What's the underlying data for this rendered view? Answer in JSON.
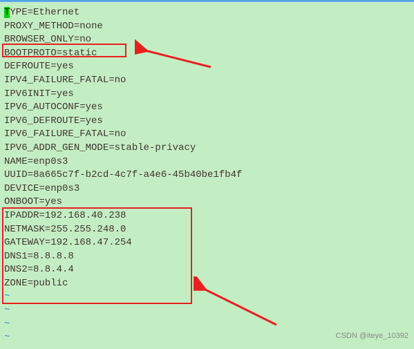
{
  "config": {
    "lines": [
      {
        "key": "TYPE",
        "value": "Ethernet",
        "cursor_on_first_char": true
      },
      {
        "key": "PROXY_METHOD",
        "value": "none"
      },
      {
        "key": "BROWSER_ONLY",
        "value": "no"
      },
      {
        "key": "BOOTPROTO",
        "value": "static"
      },
      {
        "key": "DEFROUTE",
        "value": "yes"
      },
      {
        "key": "IPV4_FAILURE_FATAL",
        "value": "no"
      },
      {
        "key": "IPV6INIT",
        "value": "yes"
      },
      {
        "key": "IPV6_AUTOCONF",
        "value": "yes"
      },
      {
        "key": "IPV6_DEFROUTE",
        "value": "yes"
      },
      {
        "key": "IPV6_FAILURE_FATAL",
        "value": "no"
      },
      {
        "key": "IPV6_ADDR_GEN_MODE",
        "value": "stable-privacy"
      },
      {
        "key": "NAME",
        "value": "enp0s3"
      },
      {
        "key": "UUID",
        "value": "8a665c7f-b2cd-4c7f-a4e6-45b40be1fb4f"
      },
      {
        "key": "DEVICE",
        "value": "enp0s3"
      },
      {
        "key": "ONBOOT",
        "value": "yes"
      },
      {
        "key": "IPADDR",
        "value": "192.168.40.238"
      },
      {
        "key": "NETMASK",
        "value": "255.255.248.0"
      },
      {
        "key": "GATEWAY",
        "value": "192.168.47.254"
      },
      {
        "key": "DNS1",
        "value": "8.8.8.8"
      },
      {
        "key": "DNS2",
        "value": "8.8.4.4"
      },
      {
        "key": "ZONE",
        "value": "public"
      }
    ],
    "tilde_count": 4
  },
  "watermark": "CSDN @iteye_10392"
}
